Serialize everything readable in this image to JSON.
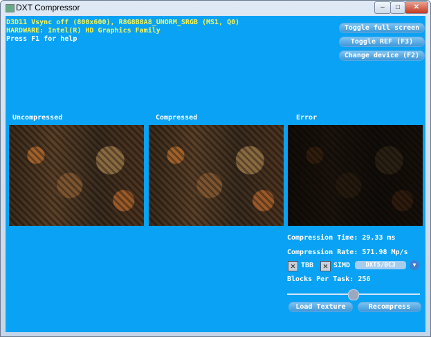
{
  "window": {
    "title": "DXT Compressor",
    "minimize": "–",
    "maximize": "□",
    "close": "✕"
  },
  "info": {
    "line1": "D3D11 Vsync off (800x600), R8G8B8A8_UNORM_SRGB (MS1, Q0)",
    "line2": "HARDWARE: Intel(R) HD Graphics Family",
    "line3": "Press F1 for help"
  },
  "top_buttons": {
    "fullscreen": "Toggle full screen",
    "ref": "Toggle REF (F3)",
    "device": "Change device (F2)"
  },
  "panels": {
    "uncompressed": "Uncompressed",
    "compressed": "Compressed",
    "error": "Error"
  },
  "stats": {
    "time": "Compression Time: 29.33 ms",
    "rate": "Compression Rate: 571.98 Mp/s",
    "blocks": "Blocks Per Task: 256"
  },
  "options": {
    "tbb_label": "TBB",
    "tbb_checked": true,
    "simd_label": "SIMD",
    "simd_checked": true,
    "format": "DXT5/BC3",
    "check_glyph": "✕",
    "arrow": "▼"
  },
  "slider": {
    "value_fraction": 0.5
  },
  "bottom_buttons": {
    "load": "Load Texture",
    "recompress": "Recompress"
  }
}
